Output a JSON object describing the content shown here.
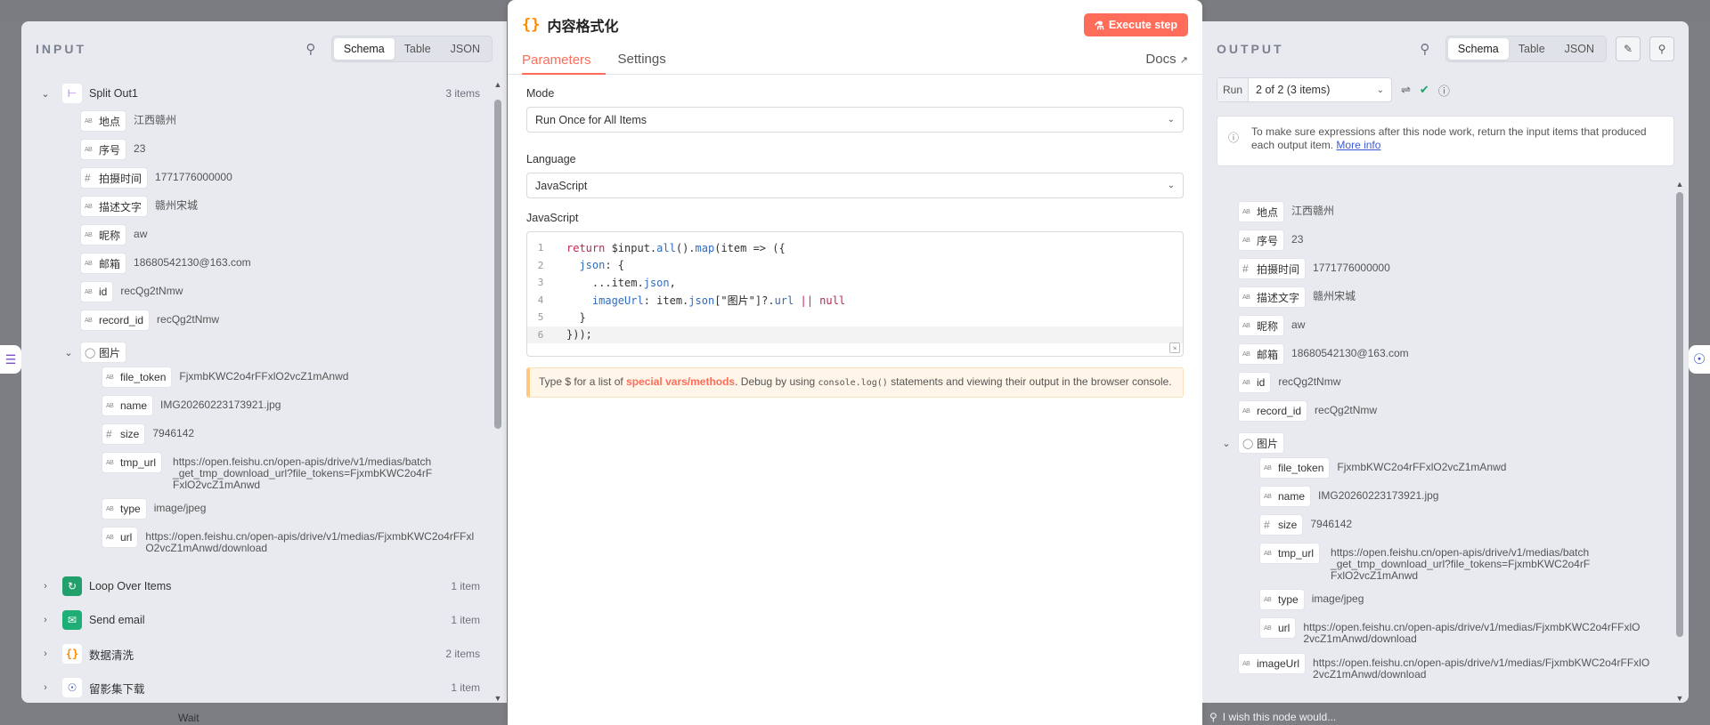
{
  "background": {
    "bottom_left_text": "Wait",
    "feedback_text": "I wish this node would..."
  },
  "input": {
    "title": "INPUT",
    "tabs": [
      "Schema",
      "Table",
      "JSON"
    ],
    "active_tab": "Schema",
    "nodes": {
      "split_out": {
        "name": "Split Out1",
        "count": "3 items"
      },
      "loop": {
        "name": "Loop Over Items",
        "count": "1 item"
      },
      "send_email": {
        "name": "Send email",
        "count": "1 item"
      },
      "clean": {
        "name": "数据清洗",
        "count": "2 items"
      },
      "download": {
        "name": "留影集下载",
        "count": "1 item"
      }
    },
    "fields": [
      {
        "key": "地点",
        "value": "江西赣州"
      },
      {
        "key": "序号",
        "value": "23"
      },
      {
        "key": "拍摄时间",
        "value": "1771776000000"
      },
      {
        "key": "描述文字",
        "value": "赣州宋城"
      },
      {
        "key": "昵称",
        "value": "aw"
      },
      {
        "key": "邮箱",
        "value": "18680542130@163.com"
      },
      {
        "key": "id",
        "value": "recQg2tNmw"
      },
      {
        "key": "record_id",
        "value": "recQg2tNmw"
      }
    ],
    "image_group": "图片",
    "image_fields": [
      {
        "key": "file_token",
        "value": "FjxmbKWC2o4rFFxlO2vcZ1mAnwd"
      },
      {
        "key": "name",
        "value": "IMG20260223173921.jpg"
      },
      {
        "key": "size",
        "value": "7946142"
      },
      {
        "key": "tmp_url",
        "value": "https://open.feishu.cn/open-apis/drive/v1/medias/batch_get_tmp_download_url?file_tokens=FjxmbKWC2o4rFFxlO2vcZ1mAnwd"
      },
      {
        "key": "type",
        "value": "image/jpeg"
      },
      {
        "key": "url",
        "value": "https://open.feishu.cn/open-apis/drive/v1/medias/FjxmbKWC2o4rFFxlO2vcZ1mAnwd/download"
      }
    ]
  },
  "center": {
    "title": "内容格式化",
    "execute_label": "Execute step",
    "tab_parameters": "Parameters",
    "tab_settings": "Settings",
    "docs_label": "Docs",
    "mode_label": "Mode",
    "mode_value": "Run Once for All Items",
    "language_label": "Language",
    "language_value": "JavaScript",
    "code_label": "JavaScript",
    "hint_prefix": "Type $ for a list of ",
    "hint_link": "special vars/methods",
    "hint_mid": ". Debug by using ",
    "hint_code": "console.log()",
    "hint_suffix": " statements and viewing their output in the browser console."
  },
  "output": {
    "title": "OUTPUT",
    "tabs": [
      "Schema",
      "Table",
      "JSON"
    ],
    "active_tab": "Schema",
    "run_label": "Run",
    "run_value": "2 of 2 (3 items)",
    "info_text": "To make sure expressions after this node work, return the input items that produced each output item.",
    "info_link": "More info",
    "extra_field": {
      "key": "imageUrl",
      "value": "https://open.feishu.cn/open-apis/drive/v1/medias/FjxmbKWC2o4rFFxlO2vcZ1mAnwd/download"
    }
  },
  "colors": {
    "accent": "#ff6d5a",
    "panel_bg": "#e8eaef",
    "link": "#3b5bd6"
  }
}
